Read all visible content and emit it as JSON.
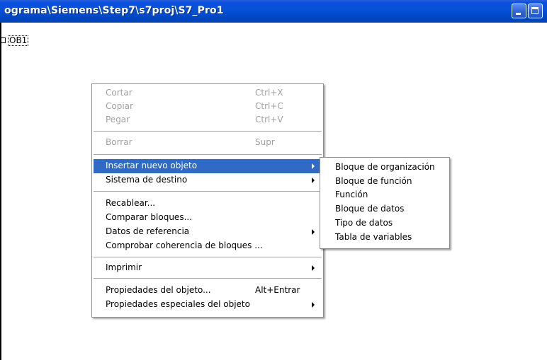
{
  "window": {
    "title": "ograma\\Siemens\\Step7\\s7proj\\S7_Pro1"
  },
  "tree": {
    "item_label": "OB1"
  },
  "context_menu": {
    "cut": {
      "label": "Cortar",
      "shortcut": "Ctrl+X"
    },
    "copy": {
      "label": "Copiar",
      "shortcut": "Ctrl+C"
    },
    "paste": {
      "label": "Pegar",
      "shortcut": "Ctrl+V"
    },
    "delete": {
      "label": "Borrar",
      "shortcut": "Supr"
    },
    "insert_new_object": {
      "label": "Insertar nuevo objeto"
    },
    "target_system": {
      "label": "Sistema de destino"
    },
    "rewire": {
      "label": "Recablear..."
    },
    "compare_blocks": {
      "label": "Comparar bloques..."
    },
    "reference_data": {
      "label": "Datos de referencia"
    },
    "check_consistency": {
      "label": "Comprobar coherencia de bloques ..."
    },
    "print": {
      "label": "Imprimir"
    },
    "object_properties": {
      "label": "Propiedades del objeto...",
      "shortcut": "Alt+Entrar"
    },
    "special_properties": {
      "label": "Propiedades especiales del objeto"
    }
  },
  "submenu": {
    "items": [
      "Bloque de organización",
      "Bloque de función",
      "Función",
      "Bloque de datos",
      "Tipo de datos",
      "Tabla de variables"
    ]
  },
  "colors": {
    "titlebar": "#0652d8",
    "highlight": "#316ac5",
    "disabled_text": "#a0a0a0"
  }
}
